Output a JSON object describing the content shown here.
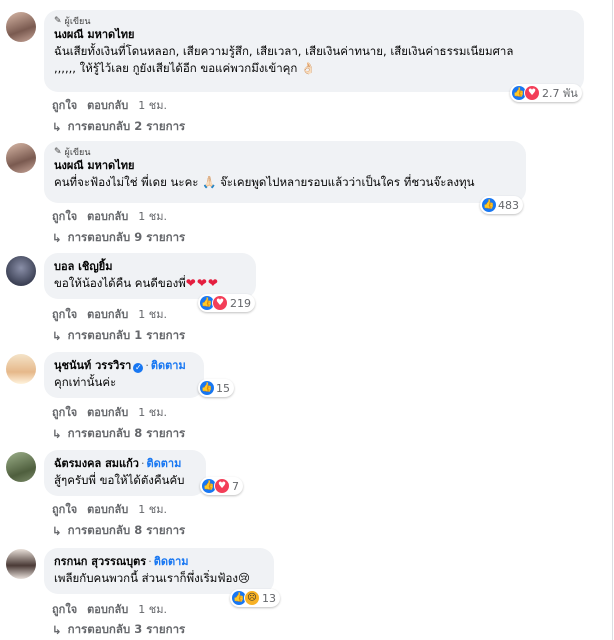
{
  "comments": [
    {
      "author_tag": "ผู้เขียน",
      "name": "นงผณี มหาดไทย",
      "lines": [
        "ฉันเสียทั้งเงินที่โดนหลอก, เสียความรู้สึก, เสียเวลา, เสียเงินค่าทนาย, เสียเงินค่าธรรมเนียมศาล",
        ",,,,,, ให้รู้ไว้เลย กูยังเสียได้อีก ขอแค่พวกมึงเข้าคุก 👌🏻"
      ],
      "like": "ถูกใจ",
      "reply": "ตอบกลับ",
      "time": "1 ชม.",
      "reaction_count": "2.7 พัน",
      "replies": "การตอบกลับ 2 รายการ"
    },
    {
      "author_tag": "ผู้เขียน",
      "name": "นงผณี มหาดไทย",
      "lines": [
        "คนที่จะฟ้องไม่ใช่ พี่เดย นะคะ 🙏🏻 จ๊ะเคยพูดไปหลายรอบแล้วว่าเป็นใคร ที่ชวนจ๊ะลงทุน"
      ],
      "like": "ถูกใจ",
      "reply": "ตอบกลับ",
      "time": "1 ชม.",
      "reaction_count": "483",
      "replies": "การตอบกลับ 9 รายการ"
    },
    {
      "name": "บอล เชิญยิ้ม",
      "lines": [
        "ขอให้น้องได้คืน คนดีของพี่"
      ],
      "hearts": "❤❤❤",
      "like": "ถูกใจ",
      "reply": "ตอบกลับ",
      "time": "1 ชม.",
      "reaction_count": "219",
      "replies": "การตอบกลับ 1 รายการ"
    },
    {
      "name": "นุชนันท์ วรรวิรา",
      "follow": "ติดตาม",
      "lines": [
        "คุกเท่านั้นค่ะ"
      ],
      "like": "ถูกใจ",
      "reply": "ตอบกลับ",
      "time": "1 ชม.",
      "reaction_count": "15",
      "replies": "การตอบกลับ 8 รายการ"
    },
    {
      "name": "ฉัตรมงคล สมแก้ว",
      "follow": "ติดตาม",
      "lines": [
        "สู้ๆครับพี่ ขอให้ได้ตังคืนคับ"
      ],
      "like": "ถูกใจ",
      "reply": "ตอบกลับ",
      "time": "1 ชม.",
      "reaction_count": "7",
      "replies": "การตอบกลับ 8 รายการ"
    },
    {
      "name": "กรกนก สุวรรณบุตร",
      "follow": "ติดตาม",
      "lines": [
        "เพลียกับคนพวกนี้ ส่วนเราก็พึ่งเริ่มฟ้อง😢"
      ],
      "like": "ถูกใจ",
      "reply": "ตอบกลับ",
      "time": "1 ชม.",
      "reaction_count": "13",
      "replies": "การตอบกลับ 3 รายการ"
    }
  ],
  "colors": {
    "accent": "#1877f2",
    "love": "#f33e58",
    "bubble": "#f0f2f5",
    "muted": "#65676b"
  },
  "icons": {
    "like": "like-icon",
    "love": "love-icon",
    "sad": "sad-icon",
    "pen": "pen-icon",
    "reply_arrow": "reply-arrow-icon",
    "verified": "verified-badge-icon"
  }
}
